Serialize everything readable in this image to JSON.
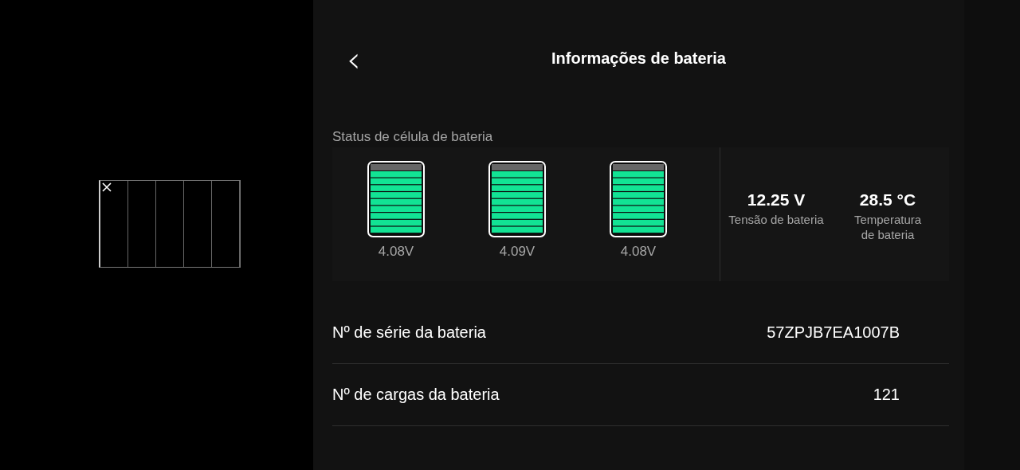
{
  "header": {
    "back": "‹",
    "title": "Informações de bateria"
  },
  "cells_section": {
    "label": "Status de célula de bateria",
    "cells": [
      {
        "reading": "4.08V"
      },
      {
        "reading": "4.09V"
      },
      {
        "reading": "4.08V"
      }
    ],
    "stats": [
      {
        "value": "12.25 V",
        "label": "Tensão de bateria"
      },
      {
        "value": "28.5 °C",
        "label": "Temperatura de bateria"
      }
    ]
  },
  "rows": [
    {
      "label": "Nº de série da bateria",
      "value": "57ZPJB7EA1007B"
    },
    {
      "label": "Nº de cargas da bateria",
      "value": "121"
    }
  ]
}
